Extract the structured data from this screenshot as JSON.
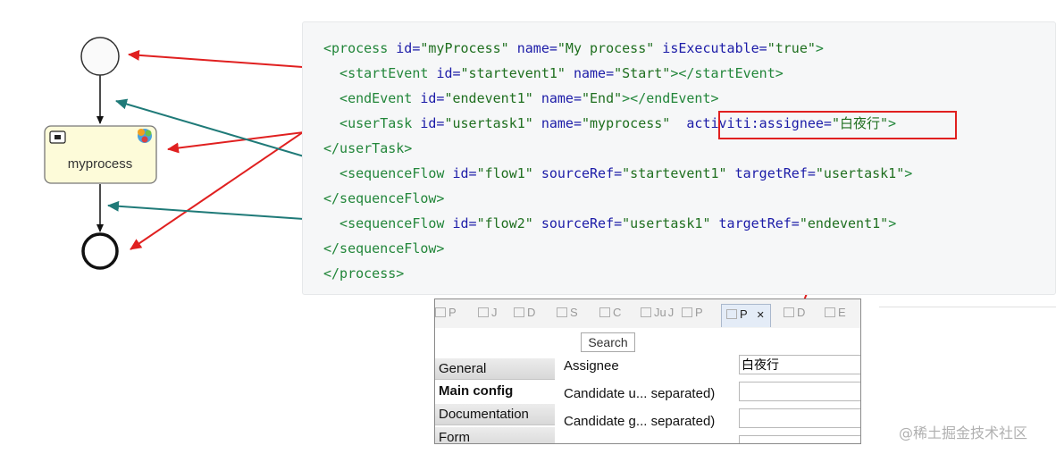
{
  "diagram": {
    "user_task_label": "myprocess"
  },
  "code_lines": [
    [
      {
        "c": "t",
        "s": "<process "
      },
      {
        "c": "a",
        "s": "id="
      },
      {
        "c": "v",
        "s": "\"myProcess\""
      },
      {
        "c": "a",
        "s": " name="
      },
      {
        "c": "v",
        "s": "\"My process\""
      },
      {
        "c": "a",
        "s": " isExecutable="
      },
      {
        "c": "v",
        "s": "\"true\""
      },
      {
        "c": "t",
        "s": ">"
      }
    ],
    [
      {
        "c": "t",
        "s": "  <startEvent "
      },
      {
        "c": "a",
        "s": "id="
      },
      {
        "c": "v",
        "s": "\"startevent1\""
      },
      {
        "c": "a",
        "s": " name="
      },
      {
        "c": "v",
        "s": "\"Start\""
      },
      {
        "c": "t",
        "s": "></startEvent>"
      }
    ],
    [
      {
        "c": "t",
        "s": "  <endEvent "
      },
      {
        "c": "a",
        "s": "id="
      },
      {
        "c": "v",
        "s": "\"endevent1\""
      },
      {
        "c": "a",
        "s": " name="
      },
      {
        "c": "v",
        "s": "\"End\""
      },
      {
        "c": "t",
        "s": "></endEvent>"
      }
    ],
    [
      {
        "c": "t",
        "s": "  <userTask "
      },
      {
        "c": "a",
        "s": "id="
      },
      {
        "c": "v",
        "s": "\"usertask1\""
      },
      {
        "c": "a",
        "s": " name="
      },
      {
        "c": "v",
        "s": "\"myprocess\""
      },
      {
        "c": "p",
        "s": "  "
      },
      {
        "c": "a",
        "s": "activiti:assignee="
      },
      {
        "c": "v",
        "s": "\"白夜行\""
      },
      {
        "c": "t",
        "s": ">"
      }
    ],
    [
      {
        "c": "t",
        "s": "</userTask>"
      }
    ],
    [
      {
        "c": "t",
        "s": "  <sequenceFlow "
      },
      {
        "c": "a",
        "s": "id="
      },
      {
        "c": "v",
        "s": "\"flow1\""
      },
      {
        "c": "a",
        "s": " sourceRef="
      },
      {
        "c": "v",
        "s": "\"startevent1\""
      },
      {
        "c": "a",
        "s": " targetRef="
      },
      {
        "c": "v",
        "s": "\"usertask1\""
      },
      {
        "c": "t",
        "s": ">"
      }
    ],
    [
      {
        "c": "t",
        "s": "</sequenceFlow>"
      }
    ],
    [
      {
        "c": "t",
        "s": "  <sequenceFlow "
      },
      {
        "c": "a",
        "s": "id="
      },
      {
        "c": "v",
        "s": "\"flow2\""
      },
      {
        "c": "a",
        "s": " sourceRef="
      },
      {
        "c": "v",
        "s": "\"usertask1\""
      },
      {
        "c": "a",
        "s": " targetRef="
      },
      {
        "c": "v",
        "s": "\"endevent1\""
      },
      {
        "c": "t",
        "s": ">"
      }
    ],
    [
      {
        "c": "t",
        "s": "</sequenceFlow>"
      }
    ],
    [
      {
        "c": "t",
        "s": "</process>"
      }
    ]
  ],
  "panel": {
    "tabs": [
      {
        "label": "P",
        "icon": "package-icon"
      },
      {
        "label": "J",
        "icon": "at-icon"
      },
      {
        "label": "D",
        "icon": "doc-icon"
      },
      {
        "label": "S",
        "icon": "rocket-icon"
      },
      {
        "label": "C",
        "icon": "console-icon"
      },
      {
        "label": "J",
        "icon": "junit-icon",
        "prefix": "Ju"
      },
      {
        "label": "P",
        "icon": "progress-icon"
      },
      {
        "label": "P",
        "icon": "properties-icon",
        "active": true
      },
      {
        "label": "D",
        "icon": "debug-icon"
      },
      {
        "label": "E",
        "icon": "error-icon"
      }
    ],
    "close_glyph": "✕",
    "search_label": "Search",
    "sidebar": [
      "General",
      "Main config",
      "Documentation",
      "Form"
    ],
    "fields": [
      {
        "label": "Assignee",
        "value": "白夜行"
      },
      {
        "label": "Candidate u... separated)",
        "value": ""
      },
      {
        "label": "Candidate g... separated)",
        "value": ""
      },
      {
        "label": "",
        "value": ""
      }
    ]
  },
  "watermark": "@稀土掘金技术社区",
  "colors": {
    "red_arrow": "#e02020",
    "teal_arrow": "#1f7a78",
    "task_fill": "#fdfbd9"
  }
}
